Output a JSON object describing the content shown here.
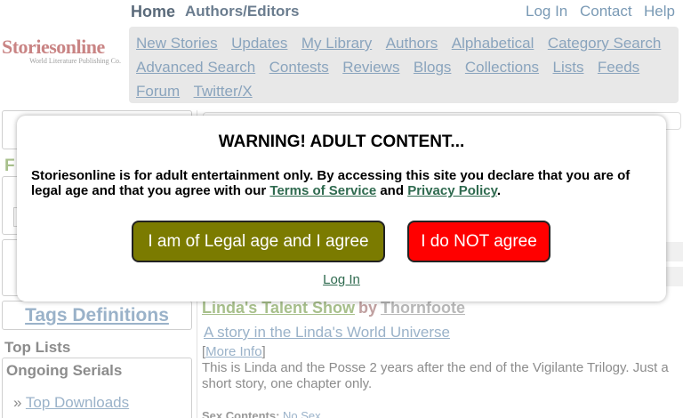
{
  "header": {
    "home": "Home",
    "authors_editors": "Authors/Editors",
    "login": "Log In",
    "contact": "Contact",
    "help": "Help"
  },
  "logo": {
    "title": "Storiesonline",
    "subtitle": "World Literature Publishing Co."
  },
  "nav": {
    "items": [
      "New Stories",
      "Updates",
      "My Library",
      "Authors",
      "Alphabetical",
      "Category Search",
      "Advanced Search",
      "Contests",
      "Reviews",
      "Blogs",
      "Collections",
      "Lists",
      "Feeds",
      "Forum",
      "Twitter/X"
    ]
  },
  "sidebar": {
    "partial_letter": "F",
    "tags_definitions": "Tags Definitions",
    "top_lists": "Top Lists",
    "ongoing_serials": "Ongoing Serials",
    "top_downloads_prefix": "»",
    "top_downloads": "Top Downloads"
  },
  "story": {
    "title": "Linda's Talent Show",
    "by": "by",
    "author": "Thornfoote",
    "universe": "A story in the Linda's World Universe",
    "more_info_open": "[",
    "more_info": "More Info",
    "more_info_close": "]",
    "description": "This is Linda and the Posse 2 years after the end of the Vigilante Trilogy. Just a short story, one chapter only.",
    "sex_contents_label": "Sex Contents:",
    "sex_contents_value": "No Sex"
  },
  "modal": {
    "title": "WARNING! ADULT CONTENT...",
    "text_before": "Storiesonline is for adult entertainment only. By accessing this site you declare that you are of legal age and that you agree with our ",
    "tos": "Terms of Service",
    "and": " and ",
    "privacy": "Privacy Policy",
    "period": ".",
    "agree_button": "I am of Legal age and I agree",
    "disagree_button": "I do NOT agree",
    "login": "Log In"
  },
  "colors": {
    "agree_button": "#7b7b00",
    "disagree_button": "#ff0000",
    "link_green": "#2f6a4f"
  }
}
